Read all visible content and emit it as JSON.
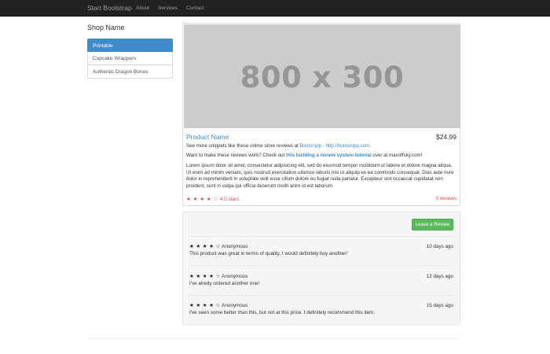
{
  "navbar": {
    "brand": "Start Bootstrap",
    "links": [
      "About",
      "Services",
      "Contact"
    ]
  },
  "sidebar": {
    "shop_name": "Shop Name",
    "items": [
      {
        "label": "Printable",
        "active": true
      },
      {
        "label": "Cupcake Wrappers",
        "active": false
      },
      {
        "label": "Authentic Dragon Bones",
        "active": false
      }
    ]
  },
  "product": {
    "image_text": "800 x 300",
    "name": "Product Name",
    "price": "$24.99",
    "snippet_prefix": "See more snippets like these online store reviews at ",
    "snippet_link": "Bootsnipp - http://bootsnipp.com",
    "snippet_suffix": ".",
    "tutorial_prefix": "Want to make these reviews work? Check out ",
    "tutorial_link": "this building a review system tutorial",
    "tutorial_suffix": " over at maxoffsky.com!",
    "description": "Lorem ipsum dolor sit amet, consectetur adipisicing elit, sed do eiusmod tempor incididunt ut labore et dolore magna aliqua. Ut enim ad minim veniam, quis nostrud exercitation ullamco laboris nisi ut aliquip ex ea commodo consequat. Duis aute irure dolor in reprehenderit in voluptate velit esse cillum dolore eu fugiat nulla pariatur. Excepteur sint occaecat cupidatat non proident, sunt in culpa qui officia deserunt mollit anim id est laborum",
    "stars": "★ ★ ★ ★ ☆",
    "rating_label": "4.0 stars",
    "review_count": "3 reviews"
  },
  "reviews_panel": {
    "button_label": "Leave a Review",
    "reviews": [
      {
        "stars": "★ ★ ★ ★ ☆",
        "author": "Anonymous",
        "date": "10 days ago",
        "text": "This product was great in terms of quality. I would definitely buy another!"
      },
      {
        "stars": "★ ★ ★ ★ ☆",
        "author": "Anonymous",
        "date": "12 days ago",
        "text": "I've alredy ordered another one!"
      },
      {
        "stars": "★ ★ ★ ★ ☆",
        "author": "Anonymous",
        "date": "15 days ago",
        "text": "I've seen some better than this, but not at this price. I definitely recommend this item."
      }
    ]
  }
}
